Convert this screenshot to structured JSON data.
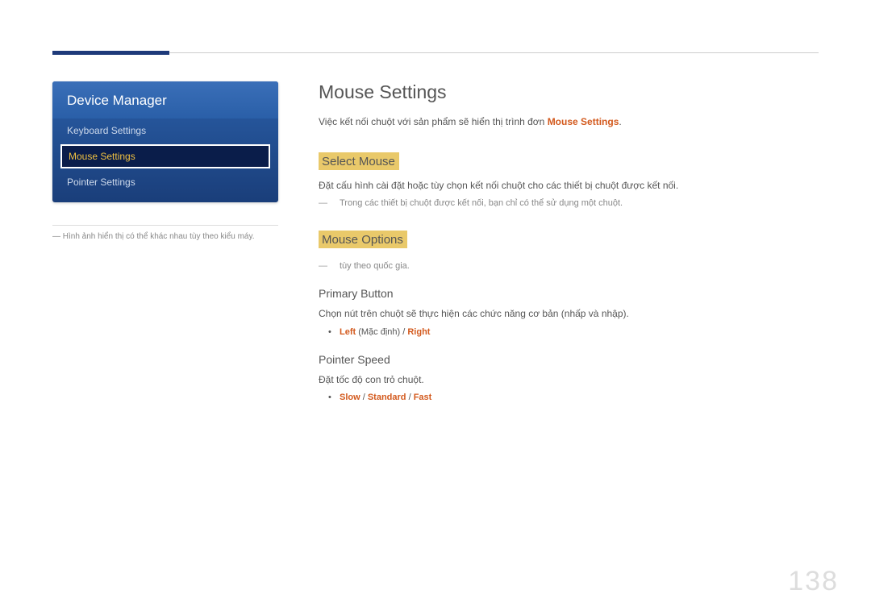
{
  "sidebar": {
    "panel_title": "Device Manager",
    "items": [
      {
        "label": "Keyboard Settings",
        "selected": false
      },
      {
        "label": "Mouse Settings",
        "selected": true
      },
      {
        "label": "Pointer Settings",
        "selected": false
      }
    ],
    "note_prefix": "― ",
    "note": "Hình ảnh hiển thị có thể khác nhau tùy theo kiểu máy."
  },
  "main": {
    "title": "Mouse Settings",
    "intro_pre": "Việc kết nối chuột với sản phẩm sẽ hiển thị trình đơn ",
    "intro_highlight": "Mouse Settings",
    "intro_post": ".",
    "section1": {
      "heading": "Select Mouse",
      "text": "Đặt cấu hình cài đặt hoặc tùy chọn kết nối chuột cho các thiết bị chuột được kết nối.",
      "note": "Trong các thiết bị chuột được kết nối, bạn chỉ có thể sử dụng một chuột."
    },
    "section2": {
      "heading": "Mouse Options",
      "note": "tùy theo quốc gia.",
      "primary": {
        "heading": "Primary Button",
        "text": "Chọn nút trên chuột sẽ thực hiện các chức năng cơ bản (nhấp và nhập).",
        "opt_left": "Left",
        "opt_paren": " (Mặc định) / ",
        "opt_right": "Right"
      },
      "speed": {
        "heading": "Pointer Speed",
        "text": "Đặt tốc độ con trỏ chuột.",
        "opt1": "Slow",
        "sep1": " / ",
        "opt2": "Standard",
        "sep2": " / ",
        "opt3": "Fast"
      }
    }
  },
  "page_number": "138"
}
